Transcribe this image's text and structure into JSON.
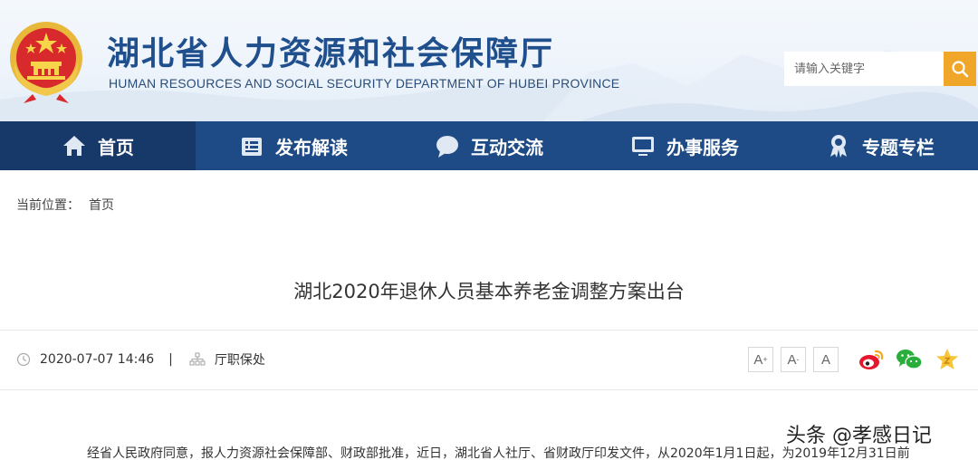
{
  "header": {
    "title": "湖北省人力资源和社会保障厅",
    "subtitle": "HUMAN RESOURCES AND SOCIAL SECURITY DEPARTMENT OF HUBEI PROVINCE",
    "search_placeholder": "请输入关键字"
  },
  "nav": [
    {
      "label": "首页",
      "icon": "home-icon"
    },
    {
      "label": "发布解读",
      "icon": "document-icon"
    },
    {
      "label": "互动交流",
      "icon": "chat-bubble-icon"
    },
    {
      "label": "办事服务",
      "icon": "monitor-icon"
    },
    {
      "label": "专题专栏",
      "icon": "medal-icon"
    }
  ],
  "breadcrumb": {
    "label": "当前位置：",
    "home": "首页"
  },
  "article": {
    "title": "湖北2020年退休人员基本养老金调整方案出台",
    "datetime": "2020-07-07 14:46",
    "separator": "|",
    "source": "厅职保处",
    "body_first_line": "经省人民政府同意，报人力资源社会保障部、财政部批准，近日，湖北省人社厅、省财政厅印发文件，从2020年1月1日起，为2019年12月31日前"
  },
  "font_size_tools": [
    {
      "label": "A",
      "mod": "+"
    },
    {
      "label": "A",
      "mod": "-"
    },
    {
      "label": "A",
      "mod": ""
    }
  ],
  "share_tools": [
    "weibo-icon",
    "wechat-icon",
    "favorite-star-icon"
  ],
  "watermark": "头条 @孝感日记",
  "colors": {
    "nav_bg": "#1e4b86",
    "nav_active": "#17396a",
    "title_blue": "#1f4f8c",
    "search_btn": "#f0a628"
  }
}
